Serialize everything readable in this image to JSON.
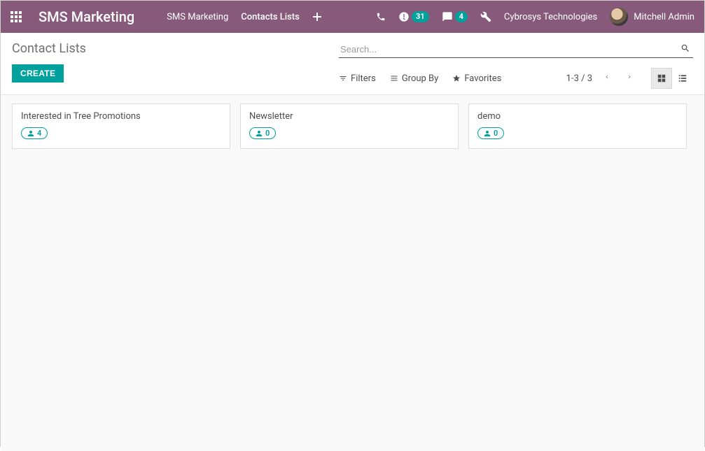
{
  "nav": {
    "brand": "SMS Marketing",
    "menu1": "SMS Marketing",
    "menu2": "Contacts Lists",
    "activity_badge": "31",
    "msg_badge": "4",
    "company": "Cybrosys Technologies",
    "user": "Mitchell Admin"
  },
  "cp": {
    "breadcrumb": "Contact Lists",
    "create": "CREATE",
    "search_placeholder": "Search...",
    "filters": "Filters",
    "groupby": "Group By",
    "favorites": "Favorites",
    "pager": "1-3 / 3"
  },
  "cards": [
    {
      "title": "Interested in Tree Promotions",
      "count": "4"
    },
    {
      "title": "Newsletter",
      "count": "0"
    },
    {
      "title": "demo",
      "count": "0"
    }
  ]
}
